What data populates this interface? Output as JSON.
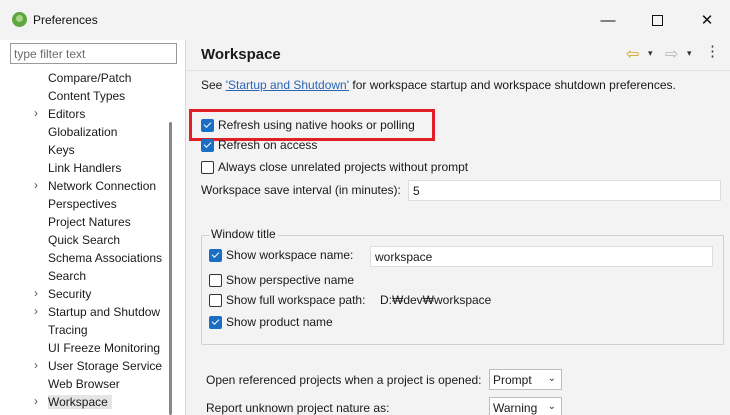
{
  "window": {
    "title": "Preferences",
    "minimize_glyph": "—",
    "close_glyph": "✕"
  },
  "sidebar": {
    "filter_placeholder": "type filter text",
    "items": [
      {
        "label": "Compare/Patch",
        "expandable": false
      },
      {
        "label": "Content Types",
        "expandable": false
      },
      {
        "label": "Editors",
        "expandable": true
      },
      {
        "label": "Globalization",
        "expandable": false
      },
      {
        "label": "Keys",
        "expandable": false
      },
      {
        "label": "Link Handlers",
        "expandable": false
      },
      {
        "label": "Network Connection",
        "expandable": true
      },
      {
        "label": "Perspectives",
        "expandable": false
      },
      {
        "label": "Project Natures",
        "expandable": false
      },
      {
        "label": "Quick Search",
        "expandable": false
      },
      {
        "label": "Schema Associations",
        "expandable": false
      },
      {
        "label": "Search",
        "expandable": false
      },
      {
        "label": "Security",
        "expandable": true
      },
      {
        "label": "Startup and Shutdow",
        "expandable": true
      },
      {
        "label": "Tracing",
        "expandable": false
      },
      {
        "label": "UI Freeze Monitoring",
        "expandable": false
      },
      {
        "label": "User Storage Service",
        "expandable": true
      },
      {
        "label": "Web Browser",
        "expandable": false
      },
      {
        "label": "Workspace",
        "expandable": true,
        "selected": true
      }
    ],
    "expand_glyph": "›"
  },
  "content": {
    "title": "Workspace",
    "nav": {
      "back_icon": "⇦",
      "forward_icon": "⇨",
      "dropdown_glyph": "▾",
      "menu_glyph": "⋮"
    },
    "see_prefix": "See ",
    "see_link": "'Startup and Shutdown'",
    "see_suffix": " for workspace startup and workspace shutdown preferences.",
    "options": {
      "refresh_native": {
        "label": "Refresh using native hooks or polling",
        "checked": true
      },
      "refresh_access": {
        "label": "Refresh on access",
        "checked": true
      },
      "always_close": {
        "label": "Always close unrelated projects without prompt",
        "checked": false
      }
    },
    "save_interval": {
      "label": "Workspace save interval (in minutes):",
      "value": "5"
    },
    "window_title": {
      "group_label": "Window title",
      "show_workspace_name": {
        "label": "Show workspace name:",
        "checked": true,
        "value": "workspace"
      },
      "show_perspective_name": {
        "label": "Show perspective name",
        "checked": false
      },
      "show_full_path": {
        "label": "Show full workspace path:",
        "checked": false,
        "value": "D:₩dev₩workspace"
      },
      "show_product_name": {
        "label": "Show product name",
        "checked": true
      }
    },
    "open_referenced": {
      "label": "Open referenced projects when a project is opened:",
      "value": "Prompt"
    },
    "report_unknown": {
      "label": "Report unknown project nature as:",
      "value": "Warning"
    },
    "combo_chevron": "⌄",
    "highlight_color": "#e02026",
    "checkbox_color": "#1a6fc4",
    "link_color": "#2a65b5"
  }
}
